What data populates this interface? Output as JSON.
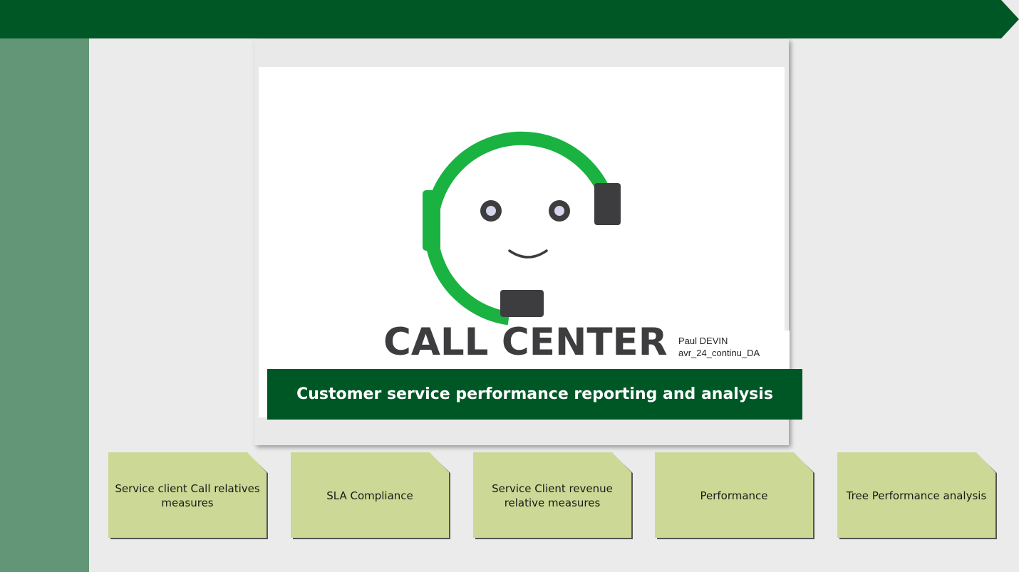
{
  "banner": {
    "color": "#005726"
  },
  "sidebar": {
    "color": "#629676"
  },
  "title_card": {
    "logo": {
      "wordmark": "CALL CENTER",
      "icon": "headset-robot-icon",
      "headset_color": "#1ab241",
      "dark_color": "#3d3d3f"
    },
    "author": {
      "name": "Paul DEVIN",
      "course": "avr_24_continu_DA"
    },
    "subtitle": "Customer service performance reporting and analysis"
  },
  "nav": {
    "tile_color": "#ccd895",
    "items": [
      {
        "label": "Service client Call relatives measures"
      },
      {
        "label": "SLA Compliance"
      },
      {
        "label": "Service Client revenue relative measures"
      },
      {
        "label": "Performance"
      },
      {
        "label": "Tree Performance analysis"
      }
    ]
  }
}
